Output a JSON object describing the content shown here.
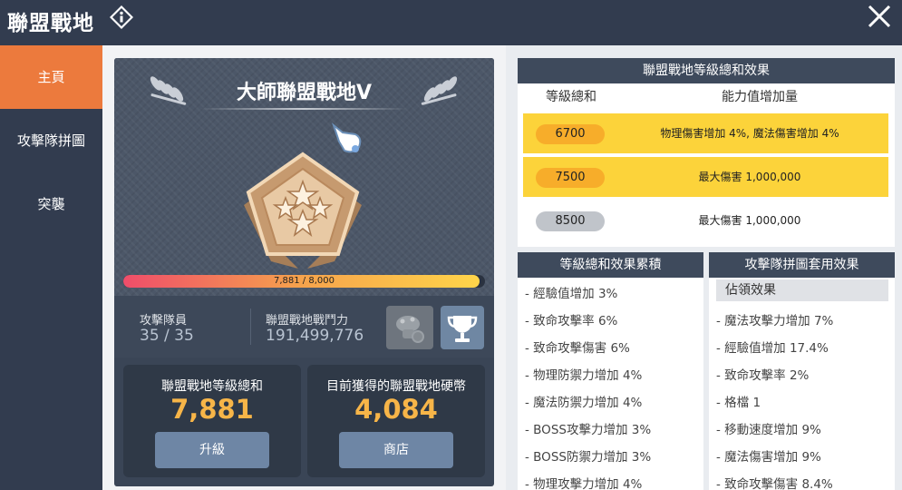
{
  "header": {
    "title": "聯盟戰地"
  },
  "sidebar": {
    "items": [
      {
        "label": "主頁",
        "active": true
      },
      {
        "label": "攻擊隊拼圖",
        "active": false
      },
      {
        "label": "突襲",
        "active": false
      }
    ]
  },
  "hero": {
    "title": "大師聯盟戰地V",
    "progress_text": "7,881 / 8,000",
    "progress_fraction": 0.985,
    "members_label": "攻擊隊員",
    "members_value": "35 / 35",
    "power_label": "聯盟戰地戰鬥力",
    "power_value": "191,499,776"
  },
  "cards": {
    "level_total_label": "聯盟戰地等級總和",
    "level_total_value": "7,881",
    "upgrade_label": "升級",
    "coins_label": "目前獲得的聯盟戰地硬幣",
    "coins_value": "4,084",
    "shop_label": "商店"
  },
  "level_effects": {
    "title": "聯盟戰地等級總和效果",
    "col_level": "等級總和",
    "col_effect": "能力值增加量",
    "rows": [
      {
        "level": "6700",
        "effect": "物理傷害增加 4%, 魔法傷害增加 4%",
        "state": "active"
      },
      {
        "level": "7500",
        "effect": "最大傷害 1,000,000",
        "state": "active"
      },
      {
        "level": "8500",
        "effect": "最大傷害 1,000,000",
        "state": "locked"
      }
    ]
  },
  "accumulated": {
    "title": "等級總和效果累積",
    "items": [
      "- 經驗值增加 3%",
      "- 致命攻擊率 6%",
      "- 致命攻擊傷害 6%",
      "- 物理防禦力增加 4%",
      "- 魔法防禦力增加 4%",
      "- BOSS攻擊力增加 3%",
      "- BOSS防禦力增加 3%",
      "- 物理攻擊力增加 4%"
    ]
  },
  "puzzle": {
    "title": "攻擊隊拼圖套用效果",
    "subtitle": "佔領效果",
    "items": [
      "- 魔法攻擊力增加 7%",
      "- 經驗值增加 17.4%",
      "- 致命攻擊率 2%",
      "- 格檔 1",
      "- 移動速度增加 9%",
      "- 魔法傷害增加 9%",
      "- 致命攻擊傷害 8.4%"
    ]
  },
  "colors": {
    "accent": "#ec7a3d",
    "header_bg": "#323c4f",
    "highlight_row": "#fcd33a",
    "value_gold": "#f7b548"
  },
  "icons": {
    "info": "info-diamond-icon",
    "close": "close-icon",
    "emblem": "pentagon-star-badge-icon",
    "wreath": "laurel-icon",
    "trophy": "trophy-icon",
    "character": "mushroom-character-icon",
    "pointer": "pointing-hand-icon"
  }
}
